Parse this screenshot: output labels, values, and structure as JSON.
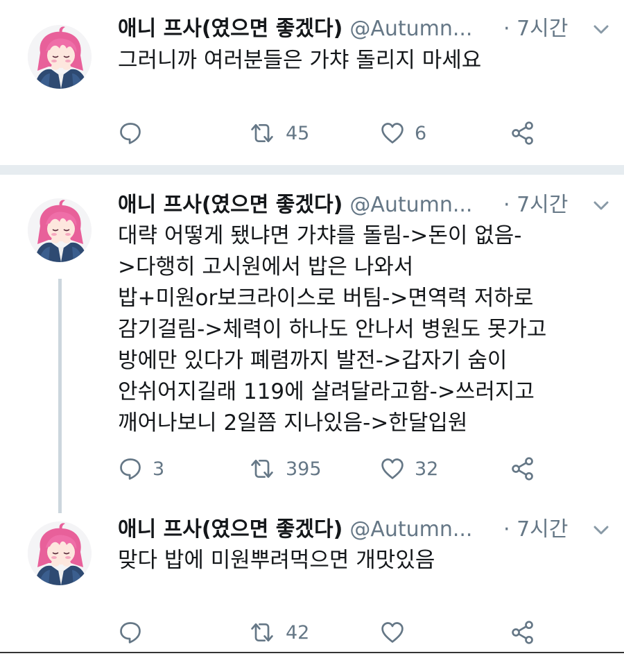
{
  "tweets": [
    {
      "display_name": "애니 프사(였으면 좋겠다)",
      "handle": "@Autumn...",
      "time": "· 7시간",
      "text": "그러니까 여러분들은 가챠 돌리지 마세요",
      "reply_count": "",
      "retweet_count": "45",
      "like_count": "6"
    },
    {
      "display_name": "애니 프사(였으면 좋겠다)",
      "handle": "@Autumn...",
      "time": "· 7시간",
      "text": "대략 어떻게 됐냐면 가챠를 돌림->돈이 없음-\n>다행히 고시원에서 밥은 나와서\n밥+미원or보크라이스로 버팀->면역력 저하로\n감기걸림->체력이 하나도 안나서 병원도 못가고\n방에만 있다가 폐렴까지 발전->갑자기 숨이\n안쉬어지길래 119에 살려달라고함->쓰러지고\n깨어나보니 2일쯤 지나있음->한달입원",
      "reply_count": "3",
      "retweet_count": "395",
      "like_count": "32"
    },
    {
      "display_name": "애니 프사(였으면 좋겠다)",
      "handle": "@Autumn...",
      "time": "· 7시간",
      "text": "맞다 밥에 미원뿌려먹으면 개맛있음",
      "reply_count": "",
      "retweet_count": "42",
      "like_count": ""
    }
  ],
  "icons": {
    "reply": "speech-bubble",
    "retweet": "retweet-arrows",
    "like": "heart-outline",
    "share": "share-nodes",
    "caret": "chevron-down"
  },
  "colors": {
    "text": "#14171a",
    "secondary": "#657786",
    "divider": "#e6ecf0",
    "thread_line": "#ccd6dd",
    "avatar_hair": "#e8609a"
  }
}
